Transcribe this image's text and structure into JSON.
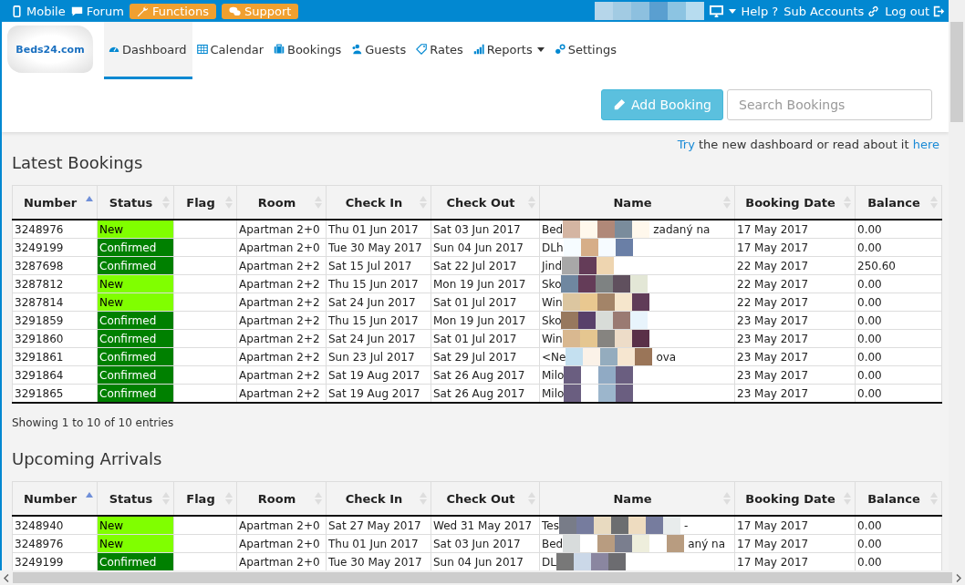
{
  "top_bar": {
    "left": [
      {
        "label": "Mobile",
        "kind": "link"
      },
      {
        "label": "Forum",
        "kind": "link"
      },
      {
        "label": "Functions",
        "kind": "button"
      },
      {
        "label": "Support",
        "kind": "button"
      }
    ],
    "right": [
      {
        "label": "Help ?"
      },
      {
        "label": "Sub Accounts"
      },
      {
        "label": "Log out"
      }
    ]
  },
  "logo": {
    "text": "Beds24.com"
  },
  "nav": [
    {
      "label": "Dashboard",
      "selected": true,
      "dropdown": false
    },
    {
      "label": "Calendar",
      "selected": false,
      "dropdown": false
    },
    {
      "label": "Bookings",
      "selected": false,
      "dropdown": false
    },
    {
      "label": "Guests",
      "selected": false,
      "dropdown": false
    },
    {
      "label": "Rates",
      "selected": false,
      "dropdown": false
    },
    {
      "label": "Reports",
      "selected": false,
      "dropdown": true
    },
    {
      "label": "Settings",
      "selected": false,
      "dropdown": false
    }
  ],
  "add_booking": {
    "label": "Add Booking"
  },
  "search": {
    "placeholder": "Search Bookings"
  },
  "notice": {
    "link": "Try",
    "text": "the new dashboard or read about it",
    "link2": "here"
  },
  "sections": [
    {
      "title": "Latest Bookings",
      "info": "Showing 1 to 10 of 10 entries",
      "columns": [
        {
          "label": "Number",
          "sorted": true
        },
        {
          "label": "Status",
          "sorted": false
        },
        {
          "label": "Flag",
          "sorted": false
        },
        {
          "label": "Room",
          "sorted": false
        },
        {
          "label": "Check In",
          "sorted": false
        },
        {
          "label": "Check Out",
          "sorted": false
        },
        {
          "label": "Name",
          "sorted": false
        },
        {
          "label": "Booking Date",
          "sorted": false
        },
        {
          "label": "Balance",
          "sorted": false
        }
      ],
      "rows": [
        {
          "number": "3248976",
          "status": "New",
          "kind": "new",
          "room": "Apartman 2+0",
          "check_in": "Thu 01 Jun 2017",
          "check_out": "Sat 03 Jun 2017",
          "name_start": "Bed",
          "name_end": "zadaný na",
          "booking_date": "17 May 2017",
          "balance": "0.00"
        },
        {
          "number": "3249199",
          "status": "Confirmed",
          "kind": "confirmed",
          "room": "Apartman 2+0",
          "check_in": "Tue 30 May 2017",
          "check_out": "Sun 04 Jun 2017",
          "name_start": "DLh",
          "booking_date": "17 May 2017",
          "balance": "0.00"
        },
        {
          "number": "3287698",
          "status": "Confirmed",
          "kind": "confirmed",
          "room": "Apartman 2+2",
          "check_in": "Sat 15 Jul 2017",
          "check_out": "Sat 22 Jul 2017",
          "name_start": "Jind",
          "booking_date": "22 May 2017",
          "balance": "250.60"
        },
        {
          "number": "3287812",
          "status": "New",
          "kind": "new",
          "room": "Apartman 2+2",
          "check_in": "Thu 15 Jun 2017",
          "check_out": "Mon 19 Jun 2017",
          "name_start": "Sko",
          "booking_date": "22 May 2017",
          "balance": "0.00"
        },
        {
          "number": "3287814",
          "status": "New",
          "kind": "new",
          "room": "Apartman 2+2",
          "check_in": "Sat 24 Jun 2017",
          "check_out": "Sat 01 Jul 2017",
          "name_start": "Win",
          "booking_date": "22 May 2017",
          "balance": "0.00"
        },
        {
          "number": "3291859",
          "status": "Confirmed",
          "kind": "confirmed",
          "room": "Apartman 2+2",
          "check_in": "Thu 15 Jun 2017",
          "check_out": "Mon 19 Jun 2017",
          "name_start": "Sko",
          "booking_date": "23 May 2017",
          "balance": "0.00"
        },
        {
          "number": "3291860",
          "status": "Confirmed",
          "kind": "confirmed",
          "room": "Apartman 2+2",
          "check_in": "Sat 24 Jun 2017",
          "check_out": "Sat 01 Jul 2017",
          "name_start": "Win",
          "booking_date": "23 May 2017",
          "balance": "0.00"
        },
        {
          "number": "3291861",
          "status": "Confirmed",
          "kind": "confirmed",
          "room": "Apartman 2+2",
          "check_in": "Sun 23 Jul 2017",
          "check_out": "Sat 29 Jul 2017",
          "name_start": "<Ne",
          "name_end": "ova",
          "booking_date": "23 May 2017",
          "balance": "0.00"
        },
        {
          "number": "3291864",
          "status": "Confirmed",
          "kind": "confirmed",
          "room": "Apartman 2+2",
          "check_in": "Sat 19 Aug 2017",
          "check_out": "Sat 26 Aug 2017",
          "name_start": "Milo",
          "booking_date": "23 May 2017",
          "balance": "0.00"
        },
        {
          "number": "3291865",
          "status": "Confirmed",
          "kind": "confirmed",
          "room": "Apartman 2+2",
          "check_in": "Sat 19 Aug 2017",
          "check_out": "Sat 26 Aug 2017",
          "name_start": "Milo",
          "booking_date": "23 May 2017",
          "balance": "0.00"
        }
      ]
    },
    {
      "title": "Upcoming Arrivals",
      "columns": [
        {
          "label": "Number",
          "sorted": true
        },
        {
          "label": "Status",
          "sorted": false
        },
        {
          "label": "Flag",
          "sorted": false
        },
        {
          "label": "Room",
          "sorted": false
        },
        {
          "label": "Check In",
          "sorted": false
        },
        {
          "label": "Check Out",
          "sorted": false
        },
        {
          "label": "Name",
          "sorted": false
        },
        {
          "label": "Booking Date",
          "sorted": false
        },
        {
          "label": "Balance",
          "sorted": false
        }
      ],
      "rows": [
        {
          "number": "3248940",
          "status": "New",
          "kind": "new",
          "room": "Apartman 2+0",
          "check_in": "Sat 27 May 2017",
          "check_out": "Wed 31 May 2017",
          "name_start": "Tes",
          "name_end": "-",
          "booking_date": "17 May 2017",
          "balance": "0.00"
        },
        {
          "number": "3248976",
          "status": "New",
          "kind": "new",
          "room": "Apartman 2+0",
          "check_in": "Thu 01 Jun 2017",
          "check_out": "Sat 03 Jun 2017",
          "name_start": "Bed",
          "name_end": "aný na",
          "booking_date": "17 May 2017",
          "balance": "0.00"
        },
        {
          "number": "3249199",
          "status": "Confirmed",
          "kind": "confirmed",
          "room": "Apartman 2+0",
          "check_in": "Tue 30 May 2017",
          "check_out": "Sun 04 Jun 2017",
          "name_start": "DL",
          "booking_date": "17 May 2017",
          "balance": "0.00"
        }
      ]
    }
  ]
}
